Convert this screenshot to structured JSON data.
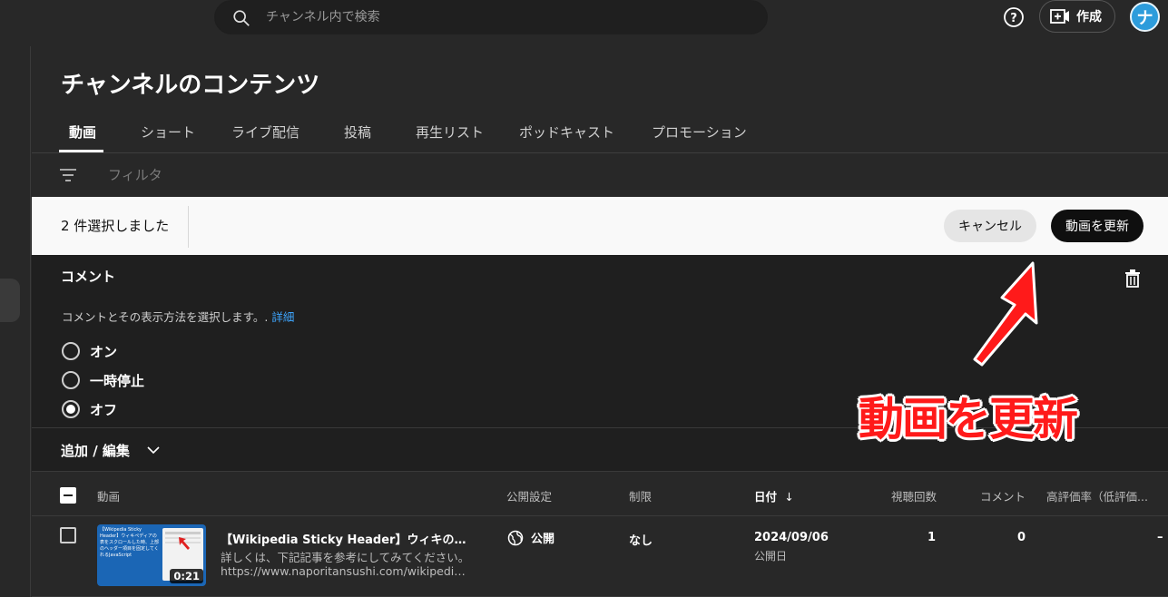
{
  "topbar": {
    "search_placeholder": "チャンネル内で検索",
    "create_label": "作成",
    "avatar_letter": "ナ"
  },
  "page": {
    "title": "チャンネルのコンテンツ",
    "tabs": [
      {
        "label": "動画",
        "active": true
      },
      {
        "label": "ショート"
      },
      {
        "label": "ライブ配信"
      },
      {
        "label": "投稿"
      },
      {
        "label": "再生リスト"
      },
      {
        "label": "ポッドキャスト"
      },
      {
        "label": "プロモーション"
      }
    ],
    "filter_placeholder": "フィルタ"
  },
  "selection": {
    "count_text": "2 件選択しました",
    "cancel_label": "キャンセル",
    "update_label": "動画を更新"
  },
  "comment_panel": {
    "title": "コメント",
    "description": "コメントとその表示方法を選択します。.",
    "details_link": "詳細",
    "options": [
      "オン",
      "一時停止",
      "オフ"
    ],
    "selected": "オフ"
  },
  "add_edit": {
    "label": "追加 / 編集"
  },
  "table": {
    "headers": {
      "video": "動画",
      "visibility": "公開設定",
      "restriction": "制限",
      "date": "日付",
      "views": "視聴回数",
      "comments": "コメント",
      "likes": "高評価率（低評価..."
    },
    "rows": [
      {
        "duration": "0:21",
        "thumb_text": "【Wikipedia Sticky Header】ウィキペディアの表をスクロールした時、上部のヘッダー項目を固定してくれるJavaScript",
        "title": "【Wikipedia Sticky Header】ウィキの表ヘッ...",
        "desc1": "詳しくは、下記記事を参考にしてみてください。",
        "desc2": "https://www.naporitansushi.com/wikipedia-stick...",
        "visibility": "公開",
        "restriction": "なし",
        "date": "2024/09/06",
        "date_sub": "公開日",
        "views": "1",
        "comments": "0",
        "likes": "–"
      }
    ]
  },
  "annotation": {
    "text": "動画を更新",
    "color": "#ff1a1a"
  }
}
